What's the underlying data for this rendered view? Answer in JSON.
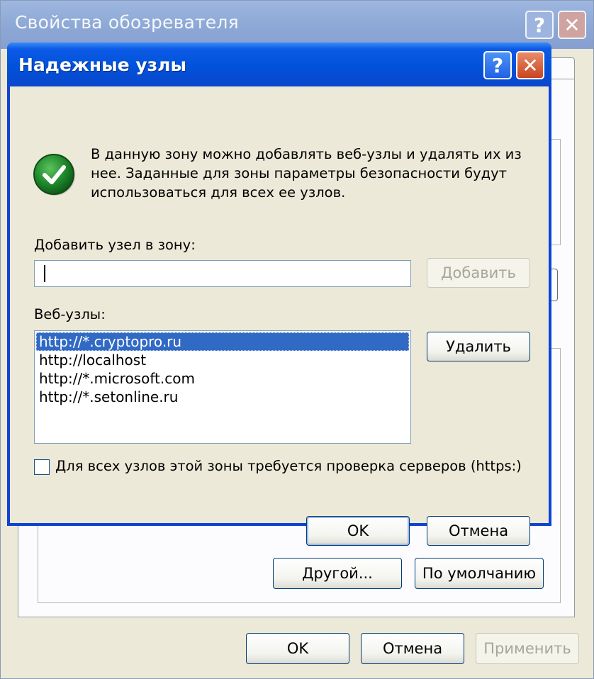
{
  "parent": {
    "title": "Свойства обозревателя",
    "buttons": {
      "other": "Другой...",
      "default": "По умолчанию",
      "ok": "OK",
      "cancel": "Отмена",
      "apply": "Применить"
    }
  },
  "dialog": {
    "title": "Надежные узлы",
    "help_glyph": "?",
    "close_glyph": "✕",
    "info_text": "В данную зону можно добавлять веб-узлы и удалять их из нее. Заданные для зоны параметры безопасности будут использоваться для всех ее узлов.",
    "add_label": "Добавить узел в зону:",
    "add_input_value": "",
    "add_button": "Добавить",
    "sites_label": "Веб-узлы:",
    "sites": [
      "http://*.cryptopro.ru",
      "http://localhost",
      "http://*.microsoft.com",
      "http://*.setonline.ru"
    ],
    "selected_site_index": 0,
    "remove_button": "Удалить",
    "https_checkbox_label": "Для всех узлов этой зоны требуется проверка серверов (https:)",
    "https_checked": false,
    "ok_button": "OK",
    "cancel_button": "Отмена"
  },
  "icons": {
    "info_icon": "green-check-icon",
    "help": "help-icon",
    "close": "close-icon"
  },
  "colors": {
    "titlebar_active": "#0152da",
    "titlebar_inactive": "#8ea9d6",
    "selection": "#316ac5",
    "check_green": "#1f8a2c"
  }
}
